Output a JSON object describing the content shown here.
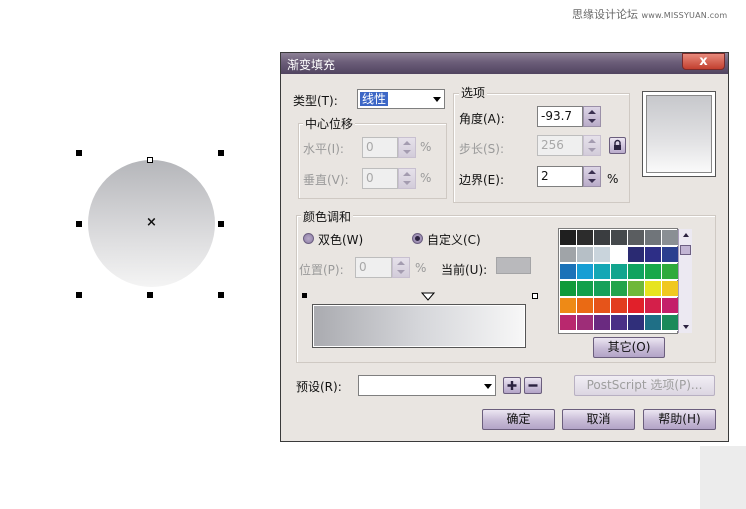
{
  "watermark": {
    "site_cn": "思缘设计论坛",
    "site_url": "www.MISSYUAN.com"
  },
  "canvas": {
    "center_marker": "×"
  },
  "dialog": {
    "title": "渐变填充",
    "close_label": "x",
    "type_label": "类型(T):",
    "type_value": "线性",
    "center_offset": {
      "title": "中心位移",
      "horizontal_label": "水平(I):",
      "horizontal_value": "0",
      "vertical_label": "垂直(V):",
      "vertical_value": "0",
      "unit": "%"
    },
    "options": {
      "title": "选项",
      "angle_label": "角度(A):",
      "angle_value": "-93.7",
      "steps_label": "步长(S):",
      "steps_value": "256",
      "edge_label": "边界(E):",
      "edge_value": "2",
      "unit": "%"
    },
    "color_blend": {
      "title": "颜色调和",
      "two_color_label": "双色(W)",
      "custom_label": "自定义(C)",
      "position_label": "位置(P):",
      "position_value": "0",
      "unit": "%",
      "current_label": "当前(U):",
      "other_button": "其它(O)",
      "palette": [
        "#1f1f1f",
        "#2c2c2c",
        "#3a3d40",
        "#45494c",
        "#5a5d60",
        "#70757a",
        "#8a8f94",
        "#a0a4a8",
        "#b6bfc6",
        "#c9d4dc",
        "#ffffff",
        "#2a2a72",
        "#2d2e86",
        "#2b3f8f",
        "#1b72b8",
        "#169ed4",
        "#13a7b5",
        "#12a58e",
        "#10a35f",
        "#18a84a",
        "#2faa3c",
        "#0f9a3a",
        "#12a04b",
        "#16a15a",
        "#22a44c",
        "#6fb83a",
        "#e7e41f",
        "#f0c81f",
        "#ee8a16",
        "#ea6a14",
        "#e6541a",
        "#e23c1f",
        "#e1202a",
        "#d41f4a",
        "#c41f6a",
        "#b9286e",
        "#9e2d78",
        "#6a2a80",
        "#4a2f86",
        "#302f7a",
        "#1f6f86",
        "#1a8a5a"
      ]
    },
    "preset_label": "预设(R):",
    "preset_value": "",
    "postscript_button": "PostScript 选项(P)...",
    "ok_button": "确定",
    "cancel_button": "取消",
    "help_button": "帮助(H)",
    "add_preset_icon": "plus-icon",
    "remove_preset_icon": "minus-icon",
    "lock_icon": "lock-icon"
  }
}
